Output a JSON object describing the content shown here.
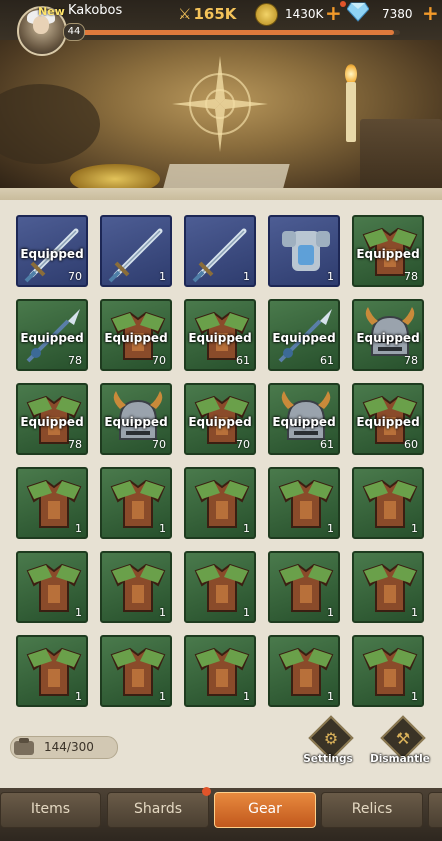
{
  "header": {
    "new_tag": "New",
    "player_name": "Kakobos",
    "level": "44",
    "xp_fraction": 0.98,
    "power": "165K",
    "gold": "1430K",
    "gems": "7380"
  },
  "inventory": {
    "equipped_label": "Equipped",
    "tiles": [
      {
        "item": "sword",
        "rarity": "blue",
        "equipped": true,
        "count": "70"
      },
      {
        "item": "sword",
        "rarity": "blue",
        "equipped": false,
        "count": "1"
      },
      {
        "item": "sword",
        "rarity": "blue",
        "equipped": false,
        "count": "1"
      },
      {
        "item": "armor",
        "rarity": "blue",
        "equipped": false,
        "count": "1"
      },
      {
        "item": "chest-armor",
        "rarity": "green",
        "equipped": true,
        "count": "78"
      },
      {
        "item": "spear",
        "rarity": "green",
        "equipped": true,
        "count": "78"
      },
      {
        "item": "chest-armor",
        "rarity": "green",
        "equipped": true,
        "count": "70"
      },
      {
        "item": "chest-armor",
        "rarity": "green",
        "equipped": true,
        "count": "61"
      },
      {
        "item": "spear",
        "rarity": "green",
        "equipped": true,
        "count": "61"
      },
      {
        "item": "helmet",
        "rarity": "green",
        "equipped": true,
        "count": "78"
      },
      {
        "item": "chest-armor",
        "rarity": "green",
        "equipped": true,
        "count": "78"
      },
      {
        "item": "helmet",
        "rarity": "green",
        "equipped": true,
        "count": "70"
      },
      {
        "item": "chest-armor",
        "rarity": "green",
        "equipped": true,
        "count": "70"
      },
      {
        "item": "helmet",
        "rarity": "green",
        "equipped": true,
        "count": "61"
      },
      {
        "item": "chest-armor",
        "rarity": "green",
        "equipped": true,
        "count": "60"
      },
      {
        "item": "chest-armor",
        "rarity": "green",
        "equipped": false,
        "count": "1"
      },
      {
        "item": "chest-armor",
        "rarity": "green",
        "equipped": false,
        "count": "1"
      },
      {
        "item": "chest-armor",
        "rarity": "green",
        "equipped": false,
        "count": "1"
      },
      {
        "item": "chest-armor",
        "rarity": "green",
        "equipped": false,
        "count": "1"
      },
      {
        "item": "chest-armor",
        "rarity": "green",
        "equipped": false,
        "count": "1"
      },
      {
        "item": "chest-armor",
        "rarity": "green",
        "equipped": false,
        "count": "1"
      },
      {
        "item": "chest-armor",
        "rarity": "green",
        "equipped": false,
        "count": "1"
      },
      {
        "item": "chest-armor",
        "rarity": "green",
        "equipped": false,
        "count": "1"
      },
      {
        "item": "chest-armor",
        "rarity": "green",
        "equipped": false,
        "count": "1"
      },
      {
        "item": "chest-armor",
        "rarity": "green",
        "equipped": false,
        "count": "1"
      },
      {
        "item": "chest-armor",
        "rarity": "green",
        "equipped": false,
        "count": "1"
      },
      {
        "item": "chest-armor",
        "rarity": "green",
        "equipped": false,
        "count": "1"
      },
      {
        "item": "chest-armor",
        "rarity": "green",
        "equipped": false,
        "count": "1"
      },
      {
        "item": "chest-armor",
        "rarity": "green",
        "equipped": false,
        "count": "1"
      },
      {
        "item": "chest-armor",
        "rarity": "green",
        "equipped": false,
        "count": "1"
      }
    ]
  },
  "footer": {
    "bag_capacity": "144/300",
    "settings_label": "Settings",
    "dismantle_label": "Dismantle"
  },
  "tabs": [
    {
      "label": "Items",
      "active": false
    },
    {
      "label": "Shards",
      "active": false
    },
    {
      "label": "Gear",
      "active": true
    },
    {
      "label": "Relics",
      "active": false
    }
  ],
  "colors": {
    "rarity_blue": "#3a4a80",
    "rarity_green": "#3a6a3e",
    "active_tab": "#d96d2c",
    "gold_text": "#f4c35a"
  }
}
